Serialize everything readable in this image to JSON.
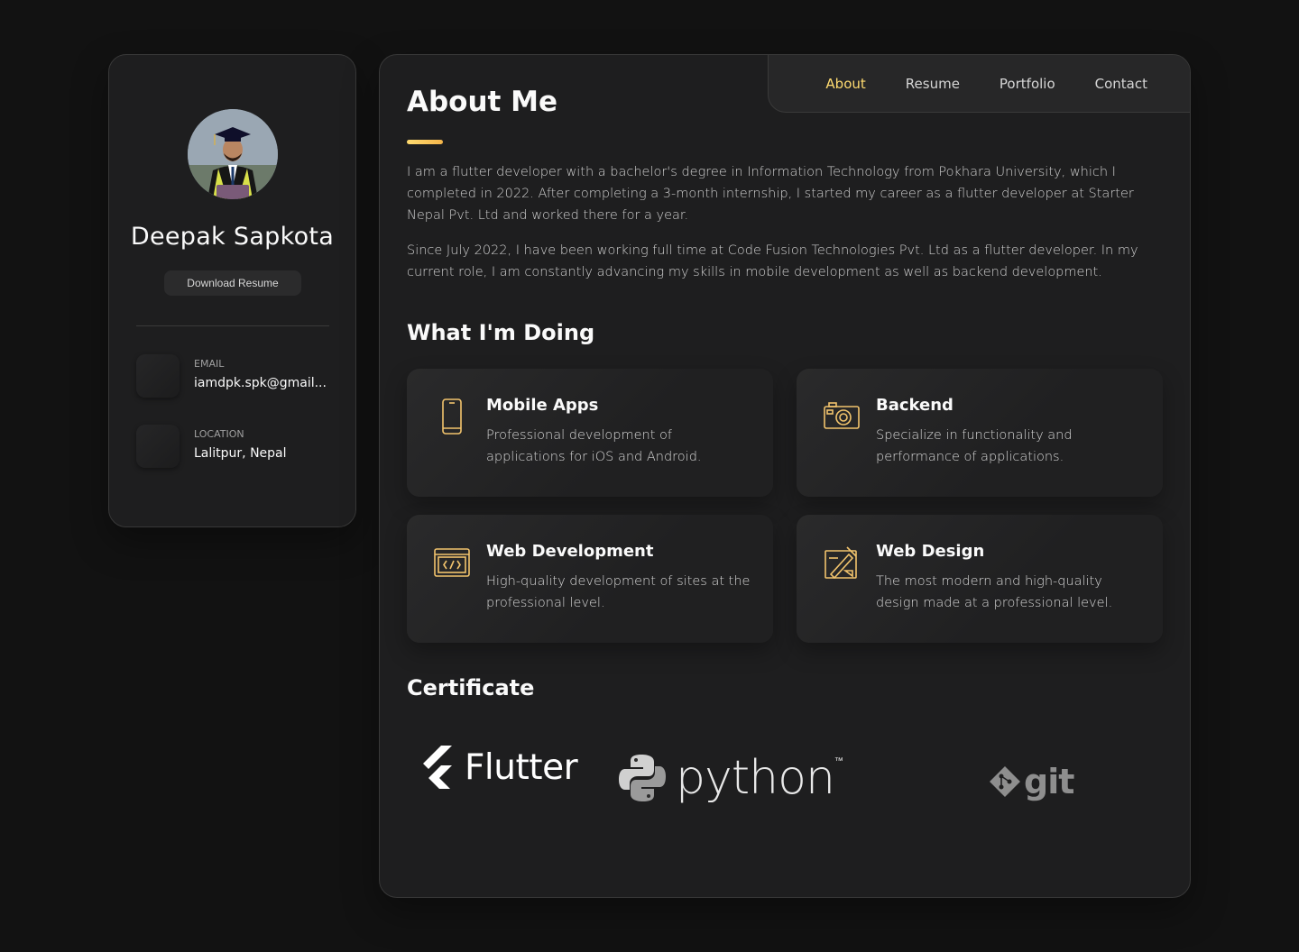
{
  "sidebar": {
    "name": "Deepak Sapkota",
    "download_label": "Download Resume",
    "contacts": [
      {
        "title": "EMAIL",
        "value": "iamdpk.spk@gmail..."
      },
      {
        "title": "LOCATION",
        "value": "Lalitpur, Nepal"
      }
    ]
  },
  "nav": {
    "items": [
      {
        "label": "About",
        "active": true
      },
      {
        "label": "Resume",
        "active": false
      },
      {
        "label": "Portfolio",
        "active": false
      },
      {
        "label": "Contact",
        "active": false
      }
    ]
  },
  "about": {
    "title": "About Me",
    "paragraphs": [
      "I am a flutter developer with a bachelor's degree in Information Technology from Pokhara University, which I completed in 2022. After completing a 3-month internship, I started my career as a flutter developer at Starter Nepal Pvt. Ltd and worked there for a year.",
      "Since July 2022, I have been working full time at Code Fusion Technologies Pvt. Ltd as a flutter developer. In my current role, I am constantly advancing my skills in mobile development as well as backend development."
    ]
  },
  "services": {
    "title": "What I'm Doing",
    "items": [
      {
        "icon": "mobile-phone-icon",
        "title": "Mobile Apps",
        "text": "Professional development of applications for iOS and Android."
      },
      {
        "icon": "camera-icon",
        "title": "Backend",
        "text": "Specialize in functionality and performance of applications."
      },
      {
        "icon": "code-window-icon",
        "title": "Web Development",
        "text": "High-quality development of sites at the professional level."
      },
      {
        "icon": "design-tools-icon",
        "title": "Web Design",
        "text": "The most modern and high-quality design made at a professional level."
      }
    ]
  },
  "certificates": {
    "title": "Certificate",
    "items": [
      {
        "name": "Flutter",
        "logo": "flutter-logo"
      },
      {
        "name": "python",
        "trademark": "™",
        "logo": "python-logo"
      },
      {
        "name": "git",
        "logo": "git-logo"
      }
    ]
  },
  "colors": {
    "accent": "#ffdb70",
    "background": "#121212",
    "card": "#1e1e1f"
  }
}
